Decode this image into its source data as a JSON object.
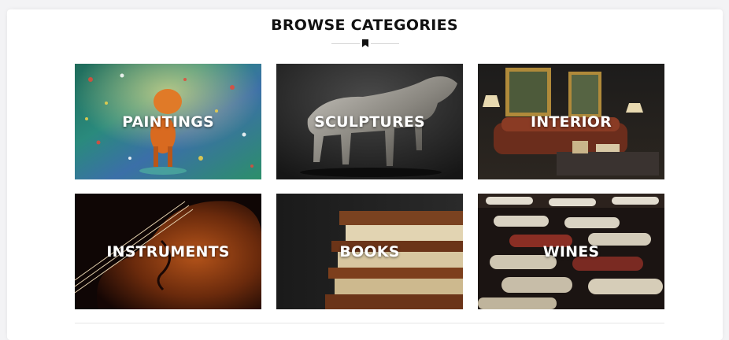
{
  "section": {
    "title": "BROWSE CATEGORIES",
    "divider_icon": "bookmark-icon"
  },
  "categories": [
    {
      "label": "PAINTINGS"
    },
    {
      "label": "SCULPTURES"
    },
    {
      "label": "INTERIOR"
    },
    {
      "label": "INSTRUMENTS"
    },
    {
      "label": "BOOKS"
    },
    {
      "label": "WINES"
    }
  ]
}
